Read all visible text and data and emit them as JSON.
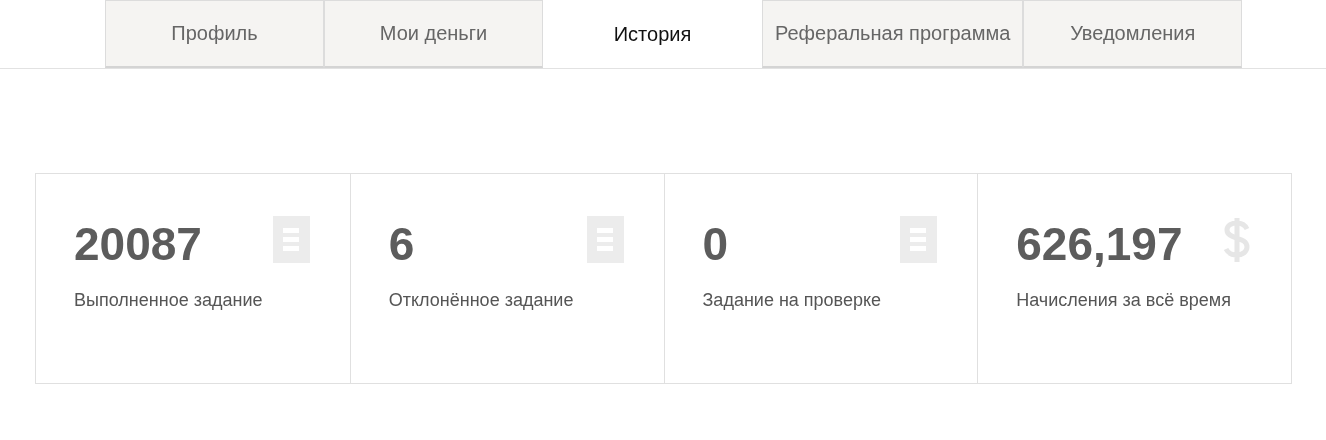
{
  "tabs": [
    {
      "label": "Профиль",
      "selected": false
    },
    {
      "label": "Мои деньги",
      "selected": false
    },
    {
      "label": "История",
      "selected": true
    },
    {
      "label": "Реферальная программа",
      "selected": false
    },
    {
      "label": "Уведомления",
      "selected": false
    }
  ],
  "stats": [
    {
      "value": "20087",
      "label": "Выполненное задание",
      "kind": "task"
    },
    {
      "value": "6",
      "label": "Отклонённое задание",
      "kind": "task"
    },
    {
      "value": "0",
      "label": "Задание на проверке",
      "kind": "task"
    },
    {
      "value": "626,197",
      "label": "Начисления за всё время",
      "kind": "money"
    }
  ]
}
